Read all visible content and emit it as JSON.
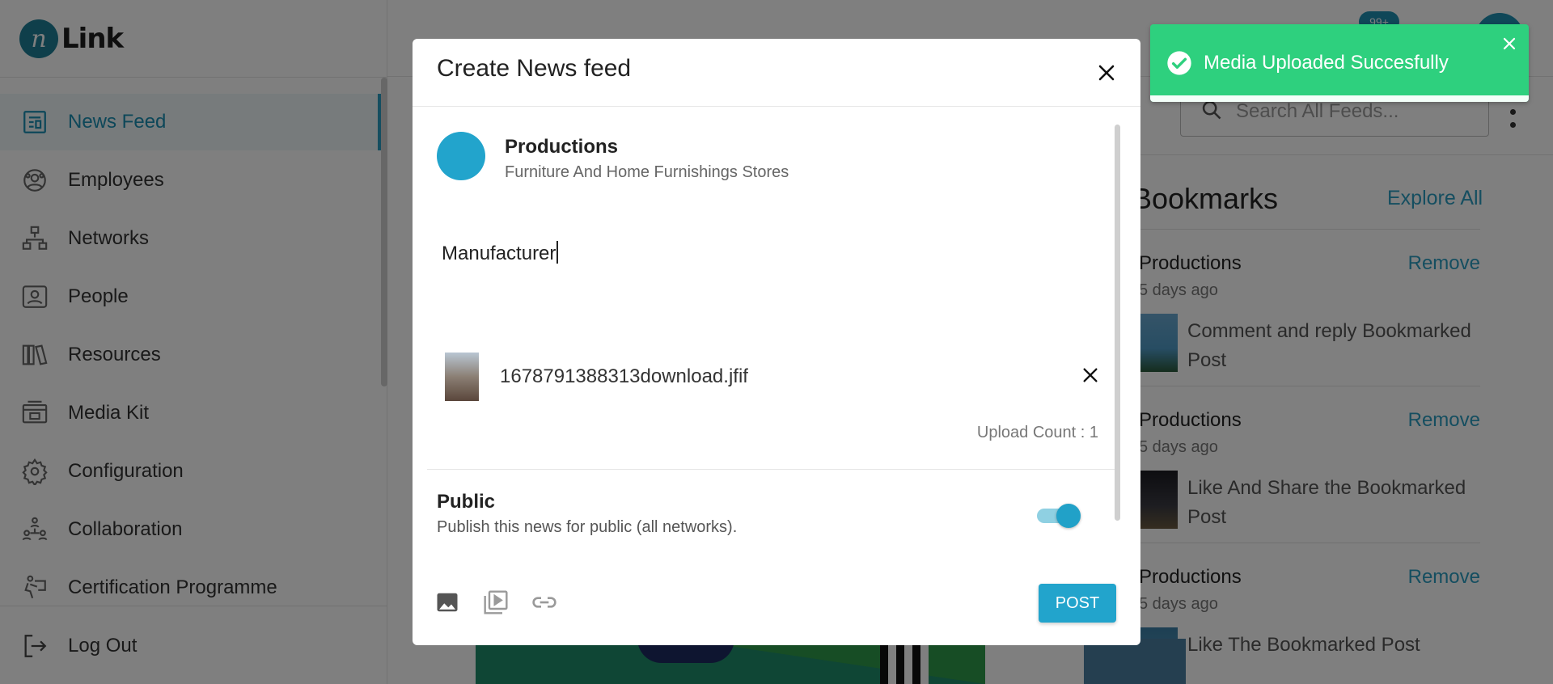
{
  "app": {
    "logo_mark": "n",
    "logo_text": "Link"
  },
  "sidebar": {
    "items": [
      {
        "label": "News Feed",
        "icon": "newspaper-icon",
        "active": true
      },
      {
        "label": "Employees",
        "icon": "employees-icon"
      },
      {
        "label": "Networks",
        "icon": "network-icon"
      },
      {
        "label": "People",
        "icon": "people-icon"
      },
      {
        "label": "Resources",
        "icon": "book-icon"
      },
      {
        "label": "Media Kit",
        "icon": "media-kit-icon"
      },
      {
        "label": "Configuration",
        "icon": "gear-icon"
      },
      {
        "label": "Collaboration",
        "icon": "collaboration-icon"
      },
      {
        "label": "Certification Programme",
        "icon": "certification-icon"
      }
    ],
    "logout_label": "Log Out"
  },
  "header": {
    "notification_badge": "99+",
    "search_placeholder": "Search All Feeds..."
  },
  "bookmarks": {
    "title": "Bookmarks",
    "explore_label": "Explore All",
    "items": [
      {
        "name": "Productions",
        "time": "5 days ago",
        "text": "Comment and reply Bookmarked Post",
        "remove_label": "Remove"
      },
      {
        "name": "Productions",
        "time": "5 days ago",
        "text": "Like And Share the Bookmarked Post",
        "remove_label": "Remove"
      },
      {
        "name": "Productions",
        "time": "5 days ago",
        "text": "Like The Bookmarked Post",
        "remove_label": "Remove"
      }
    ]
  },
  "modal": {
    "title": "Create News feed",
    "author": {
      "name": "Productions",
      "subtitle": "Furniture And Home Furnishings Stores"
    },
    "post_text": "Manufacturer",
    "attachment": {
      "file_name": "1678791388313download.jfif"
    },
    "upload_count_label": "Upload Count : 1",
    "public": {
      "title": "Public",
      "description": "Publish this news for public (all networks).",
      "enabled": true
    },
    "footer_tools": [
      "image-icon",
      "video-icon",
      "link-icon"
    ],
    "post_label": "POST"
  },
  "toast": {
    "message": "Media Uploaded Succesfully",
    "status": "success",
    "progress": 1.0
  },
  "colors": {
    "accent": "#22a4cc",
    "toast_success": "#2ed07e",
    "overlay": "rgba(0,0,0,0.5)"
  }
}
